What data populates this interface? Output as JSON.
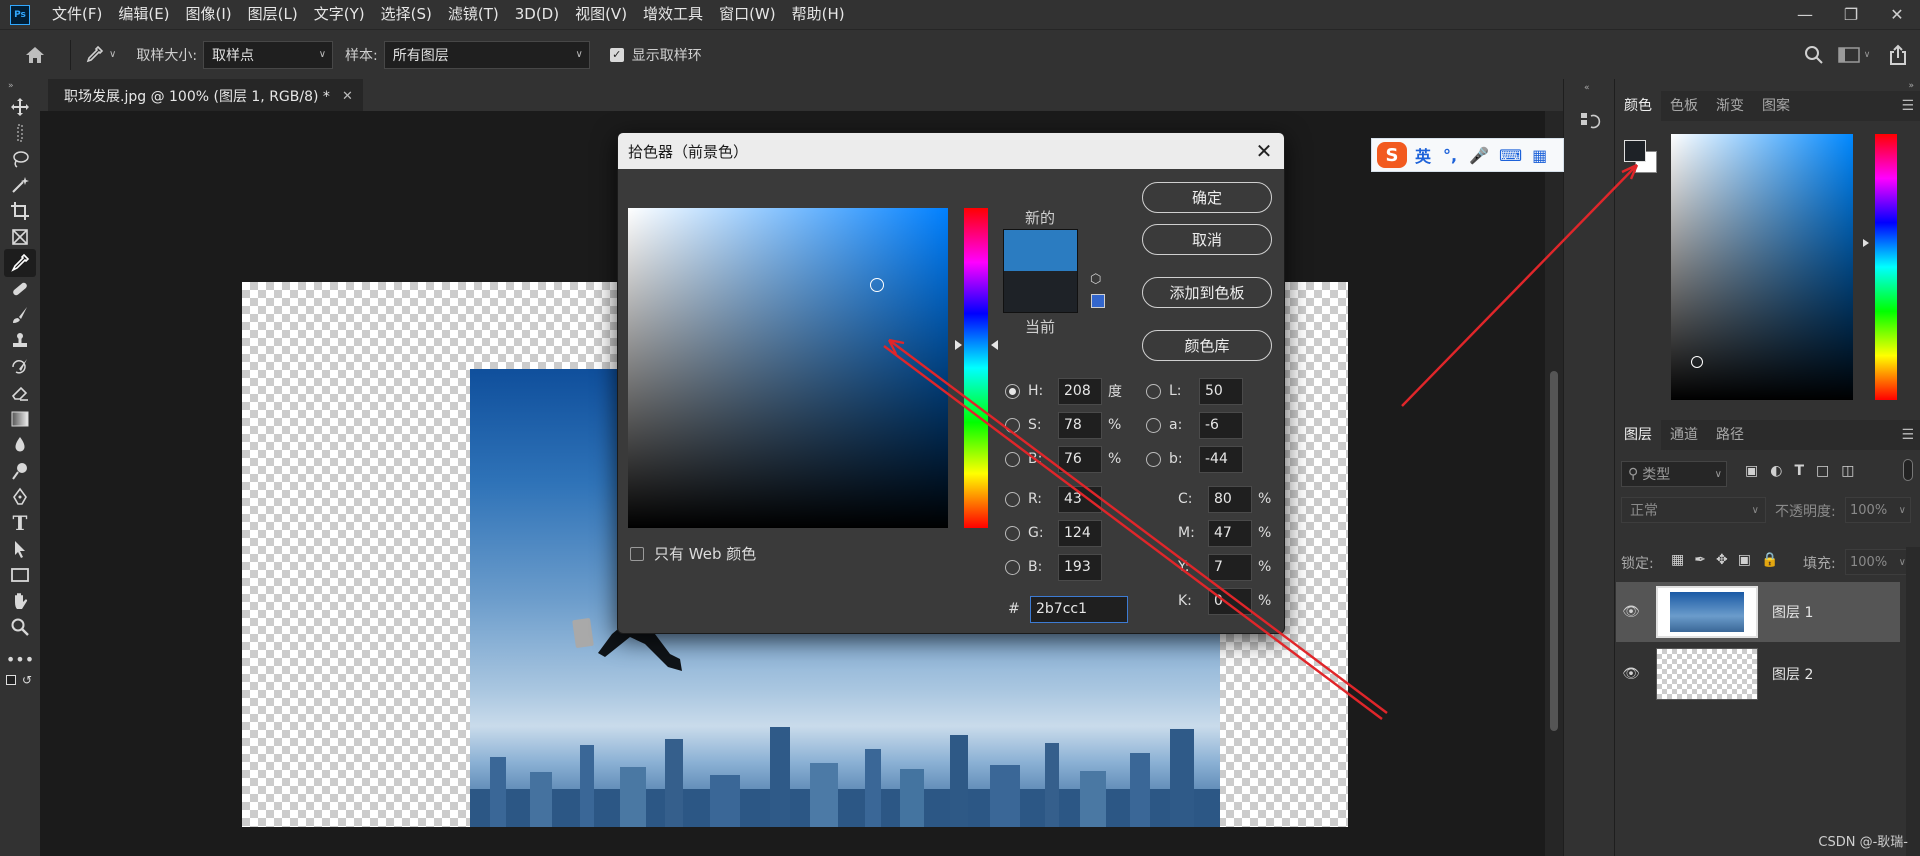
{
  "app": {
    "logo_text": "Ps"
  },
  "menubar": {
    "items": [
      "文件(F)",
      "编辑(E)",
      "图像(I)",
      "图层(L)",
      "文字(Y)",
      "选择(S)",
      "滤镜(T)",
      "3D(D)",
      "视图(V)",
      "增效工具",
      "窗口(W)",
      "帮助(H)"
    ]
  },
  "options": {
    "sample_size_label": "取样大小:",
    "sample_size_value": "取样点",
    "sample_label": "样本:",
    "sample_value": "所有图层",
    "show_ring_label": "显示取样环",
    "show_ring_checked": true
  },
  "document": {
    "tab_title": "职场发展.jpg @ 100% (图层 1, RGB/8) *"
  },
  "dialog": {
    "title": "拾色器（前景色）",
    "ok_label": "确定",
    "cancel_label": "取消",
    "add_swatch_label": "添加到色板",
    "color_library_label": "颜色库",
    "new_label": "新的",
    "current_label": "当前",
    "new_color": "#2b7cc1",
    "current_color": "#1e2227",
    "web_only_label": "只有 Web 颜色",
    "hsb": [
      {
        "label": "H:",
        "value": "208",
        "unit": "度",
        "selected": true
      },
      {
        "label": "S:",
        "value": "78",
        "unit": "%",
        "selected": false
      },
      {
        "label": "B:",
        "value": "76",
        "unit": "%",
        "selected": false
      }
    ],
    "rgb": [
      {
        "label": "R:",
        "value": "43"
      },
      {
        "label": "G:",
        "value": "124"
      },
      {
        "label": "B:",
        "value": "193"
      }
    ],
    "lab": [
      {
        "label": "L:",
        "value": "50"
      },
      {
        "label": "a:",
        "value": "-6"
      },
      {
        "label": "b:",
        "value": "-44"
      }
    ],
    "cmyk": [
      {
        "label": "C:",
        "value": "80",
        "unit": "%"
      },
      {
        "label": "M:",
        "value": "47",
        "unit": "%"
      },
      {
        "label": "Y:",
        "value": "7",
        "unit": "%"
      },
      {
        "label": "K:",
        "value": "0",
        "unit": "%"
      }
    ],
    "hex_label": "#",
    "hex_value": "2b7cc1"
  },
  "ime": {
    "lang_label": "英"
  },
  "color_panel": {
    "tabs": [
      "颜色",
      "色板",
      "渐变",
      "图案"
    ],
    "foreground": "#1e2227",
    "background": "#ffffff"
  },
  "layers_panel": {
    "tabs": [
      "图层",
      "通道",
      "路径"
    ],
    "filter_label": "类型",
    "blend_mode": "正常",
    "opacity_label": "不透明度:",
    "opacity_value": "100%",
    "lock_label": "锁定:",
    "fill_label": "填充:",
    "fill_value": "100%",
    "layers": [
      {
        "name": "图层 1",
        "selected": true
      },
      {
        "name": "图层 2",
        "selected": false
      }
    ]
  },
  "watermark": "CSDN @-耿瑞-"
}
